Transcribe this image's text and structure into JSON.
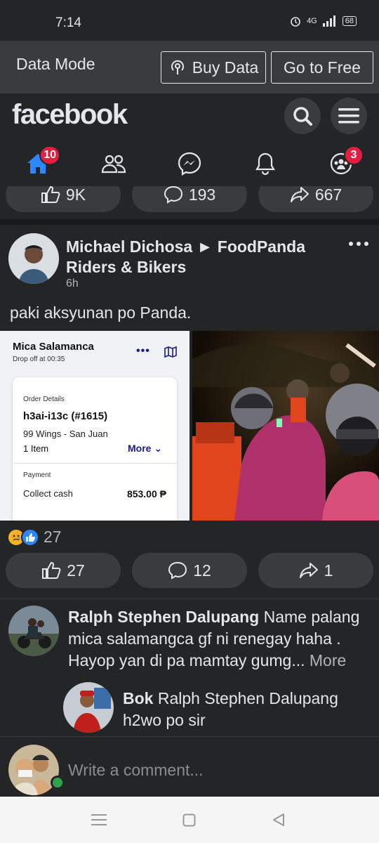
{
  "status_bar": {
    "time": "7:14",
    "network": "4G",
    "battery": "68"
  },
  "data_bar": {
    "mode_label": "Data Mode",
    "buy_label": "Buy Data",
    "free_label": "Go to Free"
  },
  "header": {
    "logo": "facebook"
  },
  "nav": {
    "home_badge": "10",
    "groups_badge": "3"
  },
  "prev_post": {
    "likes": "9K",
    "comments": "193",
    "shares": "667"
  },
  "post": {
    "author": "Michael Dichosa ► FoodPanda Riders & Bikers",
    "time": "6h",
    "text": "paki aksyunan po Panda.",
    "screenshot": {
      "name": "Mica Salamanca",
      "drop_off": "Drop off at 00:35",
      "order_label": "Order Details",
      "order_id": "h3ai-i13c (#1615)",
      "store": "99 Wings - San Juan",
      "items": "1 Item",
      "more_label": "More",
      "payment_label": "Payment",
      "collect_label": "Collect cash",
      "amount": "853.00 ₱"
    },
    "reaction_count": "27",
    "likes": "27",
    "comments": "12",
    "shares": "1"
  },
  "comments": [
    {
      "author": "Ralph Stephen Dalupang",
      "text": "Name palang mica salamangca gf ni renegay haha . Hayop yan di pa mamtay gumg...",
      "more": "More"
    },
    {
      "author": "Bok",
      "text": "Ralph Stephen Dalupang h2wo po sir"
    }
  ],
  "compose": {
    "placeholder": "Write a comment..."
  },
  "colors": {
    "background": "#18191a",
    "card": "#242526",
    "accent": "#2d88ff",
    "badge": "#e41e3f"
  }
}
